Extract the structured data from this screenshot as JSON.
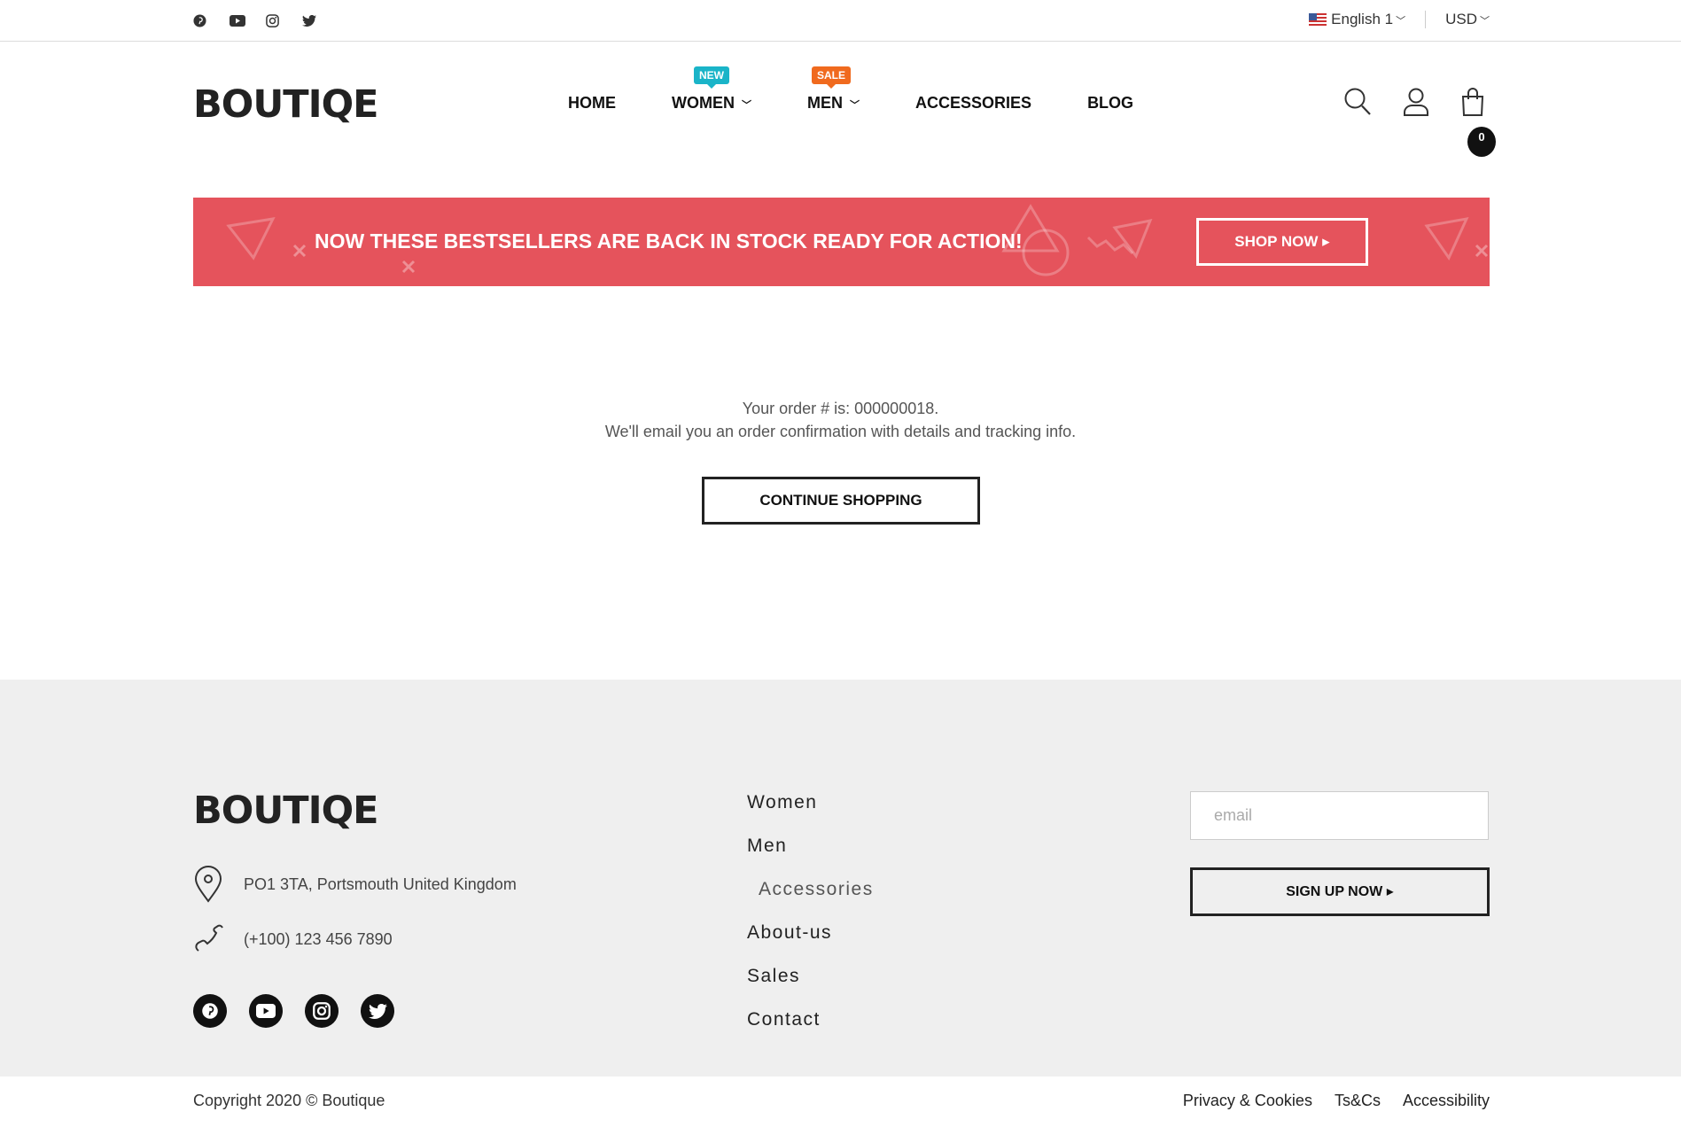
{
  "topbar": {
    "social_icons": [
      "pinterest-icon",
      "youtube-icon",
      "instagram-icon",
      "twitter-icon"
    ],
    "language": "English 1",
    "currency": "USD"
  },
  "header": {
    "logo": "BOUTIQE",
    "nav": [
      {
        "label": "HOME",
        "badge": ""
      },
      {
        "label": "WOMEN",
        "badge": "NEW",
        "dropdown": true
      },
      {
        "label": "MEN",
        "badge": "SALE",
        "dropdown": true
      },
      {
        "label": "ACCESSORIES",
        "badge": ""
      },
      {
        "label": "BLOG",
        "badge": ""
      }
    ],
    "cart_count": "0",
    "icons": [
      "search-icon",
      "user-icon",
      "cart-icon"
    ]
  },
  "banner": {
    "text": "NOW THESE BESTSELLERS ARE BACK IN STOCK READY FOR ACTION!",
    "button": "SHOP NOW ▸",
    "color": "#e5535c"
  },
  "confirmation": {
    "order_line": "Your order # is: 000000018.",
    "email_line": "We'll email you an order confirmation with details and tracking info.",
    "button": "CONTINUE SHOPPING"
  },
  "footer": {
    "logo": "BOUTIQE",
    "address": "PO1 3TA, Portsmouth United Kingdom",
    "phone": "(+100) 123 456 7890",
    "links": [
      "Women",
      "Men",
      "Accessories",
      "About-us",
      "Sales",
      "Contact"
    ],
    "email_placeholder": "email",
    "signup_button": "SIGN UP NOW ▸",
    "copyright": "Copyright 2020 © Boutique",
    "legal": [
      "Privacy & Cookies",
      "Ts&Cs",
      "Accessibility"
    ]
  }
}
